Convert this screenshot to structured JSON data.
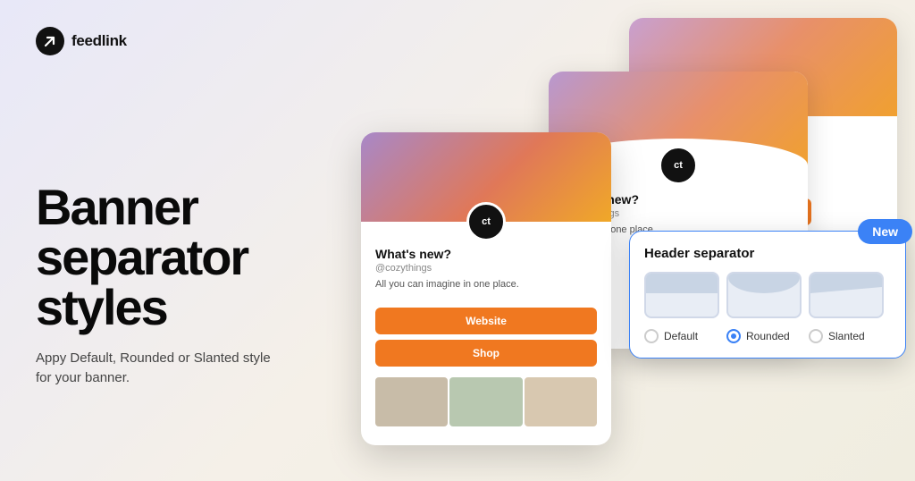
{
  "logo": {
    "text": "feedlink",
    "icon_label": "arrow-icon"
  },
  "headline": {
    "line1": "Banner",
    "line2": "separator",
    "line3": "styles"
  },
  "subtext": "Appy Default, Rounded or Slanted style for your banner.",
  "cards": {
    "handle": "@cozythings",
    "title": "What's new?",
    "desc": "All you can imagine in one place.",
    "desc_short": "imagine in one place.",
    "avatar_initials": "ct",
    "website_btn": "Website",
    "shop_btn": "Shop"
  },
  "separator_panel": {
    "title": "Header separator",
    "styles": [
      {
        "id": "default",
        "label": "Default"
      },
      {
        "id": "rounded",
        "label": "Rounded"
      },
      {
        "id": "slanted",
        "label": "Slanted"
      }
    ],
    "selected": "rounded",
    "new_badge": "New"
  }
}
